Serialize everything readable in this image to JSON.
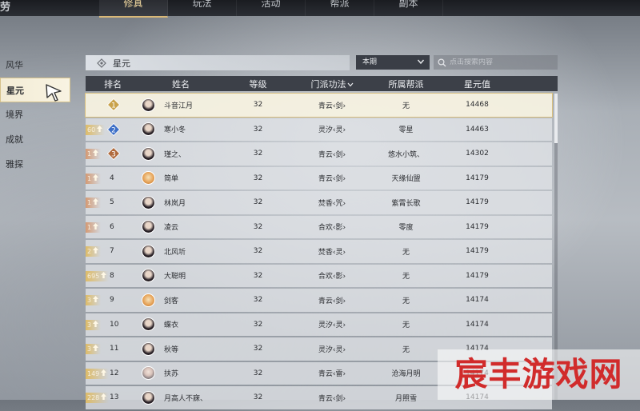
{
  "corner": "劳",
  "tabs": [
    {
      "label": "修真",
      "active": true
    },
    {
      "label": "玩法",
      "active": false
    },
    {
      "label": "活动",
      "active": false
    },
    {
      "label": "帮派",
      "active": false
    },
    {
      "label": "副本",
      "active": false
    }
  ],
  "sidebar": {
    "items": [
      {
        "label": "风华"
      },
      {
        "label": "星元"
      },
      {
        "label": "境界"
      },
      {
        "label": "成就"
      },
      {
        "label": "雅探"
      }
    ],
    "active_index": 1
  },
  "panel": {
    "title": "星元"
  },
  "filter": {
    "selected": "本期"
  },
  "search": {
    "placeholder": "点击搜索内容"
  },
  "table": {
    "headers": {
      "rank": "排名",
      "name": "姓名",
      "level": "等级",
      "school": "门派功法",
      "guild": "所属帮派",
      "value": "星元值"
    },
    "rows": [
      {
        "change": "",
        "rank": "1",
        "badge": "gold",
        "avatar": "dark",
        "name": "斗音江月",
        "level": "32",
        "school": "青云‹剑›",
        "guild": "无",
        "value": "14468"
      },
      {
        "change": "60",
        "rank": "2",
        "badge": "blue",
        "avatar": "dark",
        "name": "寒小冬",
        "level": "32",
        "school": "灵汐‹灵›",
        "guild": "零星",
        "value": "14463"
      },
      {
        "change": "1",
        "rank": "3",
        "badge": "bronze",
        "avatar": "dark",
        "name": "瑾之、",
        "level": "32",
        "school": "青云‹剑›",
        "guild": "悠水小筑、",
        "value": "14302"
      },
      {
        "change": "1",
        "rank": "4",
        "badge": "",
        "avatar": "orange",
        "name": "简单",
        "level": "32",
        "school": "青云‹剑›",
        "guild": "天缘仙盟",
        "value": "14179"
      },
      {
        "change": "1",
        "rank": "5",
        "badge": "",
        "avatar": "dark",
        "name": "林岚月",
        "level": "32",
        "school": "焚香‹咒›",
        "guild": "紫霄长歌",
        "value": "14179"
      },
      {
        "change": "1",
        "rank": "6",
        "badge": "",
        "avatar": "dark",
        "name": "凌云",
        "level": "32",
        "school": "合欢‹影›",
        "guild": "零度",
        "value": "14179"
      },
      {
        "change": "2",
        "rank": "7",
        "badge": "",
        "avatar": "dark",
        "name": "北风圻",
        "level": "32",
        "school": "焚香‹灵›",
        "guild": "无",
        "value": "14179"
      },
      {
        "change": "695",
        "rank": "8",
        "badge": "",
        "avatar": "dark",
        "name": "大聪明",
        "level": "32",
        "school": "合欢‹影›",
        "guild": "无",
        "value": "14179"
      },
      {
        "change": "3",
        "rank": "9",
        "badge": "",
        "avatar": "orange",
        "name": "剑客",
        "level": "32",
        "school": "青云‹剑›",
        "guild": "无",
        "value": "14174"
      },
      {
        "change": "3",
        "rank": "10",
        "badge": "",
        "avatar": "dark",
        "name": "蝶衣",
        "level": "32",
        "school": "灵汐‹灵›",
        "guild": "无",
        "value": "14174"
      },
      {
        "change": "3",
        "rank": "11",
        "badge": "",
        "avatar": "dark",
        "name": "秋等",
        "level": "32",
        "school": "灵汐‹灵›",
        "guild": "无",
        "value": "14174"
      },
      {
        "change": "149",
        "rank": "12",
        "badge": "",
        "avatar": "light",
        "name": "扶苏",
        "level": "32",
        "school": "青云‹雷›",
        "guild": "沧海月明",
        "value": "14174"
      },
      {
        "change": "228",
        "rank": "13",
        "badge": "",
        "avatar": "dark",
        "name": "月高人不寐、",
        "level": "32",
        "school": "青云‹剑›",
        "guild": "月照雪",
        "value": "14174"
      }
    ]
  },
  "watermark": "宸丰游戏网",
  "colors": {
    "accent": "#d9b877",
    "gold_badge": "#c9a24a",
    "blue_badge": "#3d6fc7",
    "bronze_badge": "#b06a3d",
    "watermark": "#d12b2b"
  }
}
